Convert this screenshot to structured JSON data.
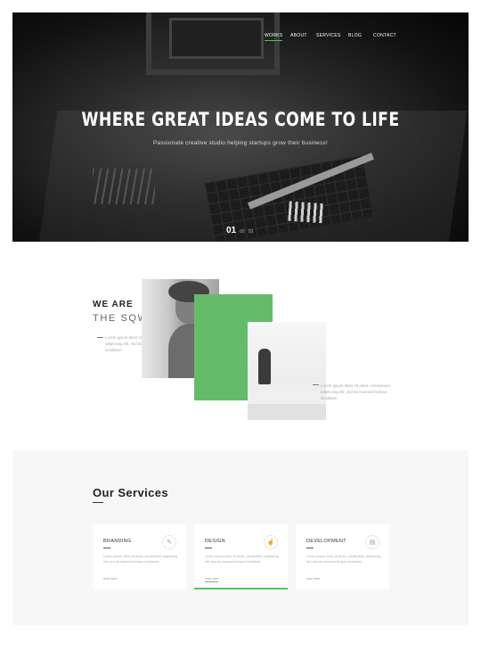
{
  "nav": {
    "items": [
      {
        "label": "WORKS",
        "active": true
      },
      {
        "label": "ABOUT",
        "active": false
      },
      {
        "label": "SERVICES",
        "active": false
      },
      {
        "label": "BLOG",
        "active": false
      },
      {
        "label": "CONTACT",
        "active": false
      }
    ]
  },
  "hero": {
    "title": "WHERE GREAT IDEAS COME TO LIFE",
    "subtitle": "Passionate creative studio helping startups grow their business!",
    "slider": {
      "current": "01",
      "others": [
        "02",
        "03"
      ]
    }
  },
  "about": {
    "title_line1": "WE ARE",
    "title_line2": "THE SQWD",
    "text1": "Lorem ipsum dolor sit amet, consectetur adipiscing elit, sed do eiusmod tempor incididunt",
    "text2": "Lorem ipsum dolor sit amet, consectetur adipiscing elit, sed do eiusmod tempor incididunt"
  },
  "services": {
    "title": "Our Services",
    "cards": [
      {
        "title": "BRANDING",
        "icon": "pencil-icon",
        "glyph": "✎",
        "text": "Lorem ipsum dolor sit amet, consectetur adipiscing elit, sed do eiusmod tempor incididunt.",
        "link": "read more",
        "active": false
      },
      {
        "title": "DESIGN",
        "icon": "hand-pointer-icon",
        "glyph": "☝",
        "text": "Lorem ipsum dolor sit amet, consectetur adipiscing elit, sed do eiusmod tempor incididunt.",
        "link": "read more",
        "active": true
      },
      {
        "title": "DEVELOPMENT",
        "icon": "browser-window-icon",
        "glyph": "▤",
        "text": "Lorem ipsum dolor sit amet, consectetur adipiscing elit, sed do eiusmod tempor incididunt.",
        "link": "read more",
        "active": false
      }
    ]
  },
  "colors": {
    "accent": "#66bb6a",
    "hero_bg": "#111111",
    "services_bg": "#f7f7f7"
  }
}
